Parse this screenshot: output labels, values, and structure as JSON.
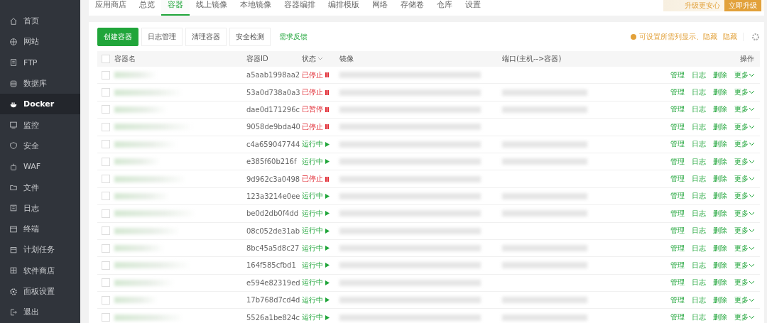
{
  "sidebar": {
    "items": [
      {
        "label": "首页",
        "selected": false
      },
      {
        "label": "网站",
        "selected": false
      },
      {
        "label": "FTP",
        "selected": false
      },
      {
        "label": "数据库",
        "selected": false
      },
      {
        "label": "Docker",
        "selected": true
      },
      {
        "label": "监控",
        "selected": false
      },
      {
        "label": "安全",
        "selected": false
      },
      {
        "label": "WAF",
        "selected": false
      },
      {
        "label": "文件",
        "selected": false
      },
      {
        "label": "日志",
        "selected": false
      },
      {
        "label": "终端",
        "selected": false
      },
      {
        "label": "计划任务",
        "selected": false
      },
      {
        "label": "软件商店",
        "selected": false
      },
      {
        "label": "面板设置",
        "selected": false
      },
      {
        "label": "退出",
        "selected": false
      }
    ]
  },
  "tabs": [
    {
      "label": "应用商店",
      "selected": false
    },
    {
      "label": "总览",
      "selected": false
    },
    {
      "label": "容器",
      "selected": true
    },
    {
      "label": "线上镜像",
      "selected": false
    },
    {
      "label": "本地镜像",
      "selected": false
    },
    {
      "label": "容器编排",
      "selected": false
    },
    {
      "label": "编排模版",
      "selected": false
    },
    {
      "label": "网络",
      "selected": false
    },
    {
      "label": "存储卷",
      "selected": false
    },
    {
      "label": "仓库",
      "selected": false
    },
    {
      "label": "设置",
      "selected": false
    }
  ],
  "promo": {
    "text": "升级更安心",
    "button": "立即升级"
  },
  "toolbar": {
    "buttons": [
      {
        "label": "创建容器",
        "kind": "primary"
      },
      {
        "label": "日志管理",
        "kind": "default"
      },
      {
        "label": "清理容器",
        "kind": "default"
      },
      {
        "label": "安全检测",
        "kind": "default"
      },
      {
        "label": "需求反馈",
        "kind": "link"
      }
    ],
    "hint": "可设置所需列显示、隐藏",
    "hint_link": "隐藏"
  },
  "table": {
    "header_checked": false,
    "columns": [
      "容器名",
      "容器ID",
      "状态",
      "镜像",
      "端口(主机-->容器)",
      "操作"
    ],
    "rows": [
      {
        "checked": false,
        "id": "a5aab1998aa2",
        "status": "已停止",
        "kind": "stopped",
        "actions": [
          "管理",
          "日志",
          "删除",
          "更多"
        ]
      },
      {
        "checked": false,
        "id": "53a0d738a0a3",
        "status": "已停止",
        "kind": "stopped",
        "actions": [
          "管理",
          "日志",
          "删除",
          "更多"
        ]
      },
      {
        "checked": false,
        "id": "dae0d171296c",
        "status": "已暂停",
        "kind": "paused",
        "actions": [
          "管理",
          "日志",
          "删除",
          "更多"
        ]
      },
      {
        "checked": false,
        "id": "9058de9bda40",
        "status": "已停止",
        "kind": "stopped",
        "actions": [
          "管理",
          "日志",
          "删除",
          "更多"
        ]
      },
      {
        "checked": false,
        "id": "c4a659047744",
        "status": "运行中",
        "kind": "running",
        "actions": [
          "管理",
          "日志",
          "删除",
          "更多"
        ]
      },
      {
        "checked": false,
        "id": "e385f60b216f",
        "status": "运行中",
        "kind": "running",
        "actions": [
          "管理",
          "日志",
          "删除",
          "更多"
        ]
      },
      {
        "checked": false,
        "id": "9d962c3a0498",
        "status": "已停止",
        "kind": "stopped",
        "actions": [
          "管理",
          "日志",
          "删除",
          "更多"
        ]
      },
      {
        "checked": false,
        "id": "123a3214e0ee",
        "status": "运行中",
        "kind": "running",
        "actions": [
          "管理",
          "日志",
          "删除",
          "更多"
        ]
      },
      {
        "checked": false,
        "id": "be0d2db0f4dd",
        "status": "运行中",
        "kind": "running",
        "actions": [
          "管理",
          "日志",
          "删除",
          "更多"
        ]
      },
      {
        "checked": false,
        "id": "08c052de31ab",
        "status": "运行中",
        "kind": "running",
        "actions": [
          "管理",
          "日志",
          "删除",
          "更多"
        ]
      },
      {
        "checked": false,
        "id": "8bc45a5d8c27",
        "status": "运行中",
        "kind": "running",
        "actions": [
          "管理",
          "日志",
          "删除",
          "更多"
        ]
      },
      {
        "checked": false,
        "id": "164f585cfbd1",
        "status": "运行中",
        "kind": "running",
        "actions": [
          "管理",
          "日志",
          "删除",
          "更多"
        ]
      },
      {
        "checked": false,
        "id": "e594e82319ed",
        "status": "运行中",
        "kind": "running",
        "actions": [
          "管理",
          "日志",
          "删除",
          "更多"
        ]
      },
      {
        "checked": false,
        "id": "17b768d7cd4d",
        "status": "运行中",
        "kind": "running",
        "actions": [
          "管理",
          "日志",
          "删除",
          "更多"
        ]
      },
      {
        "checked": false,
        "id": "5526a1be824c",
        "status": "运行中",
        "kind": "running",
        "actions": [
          "管理",
          "日志",
          "删除",
          "更多"
        ]
      }
    ]
  }
}
